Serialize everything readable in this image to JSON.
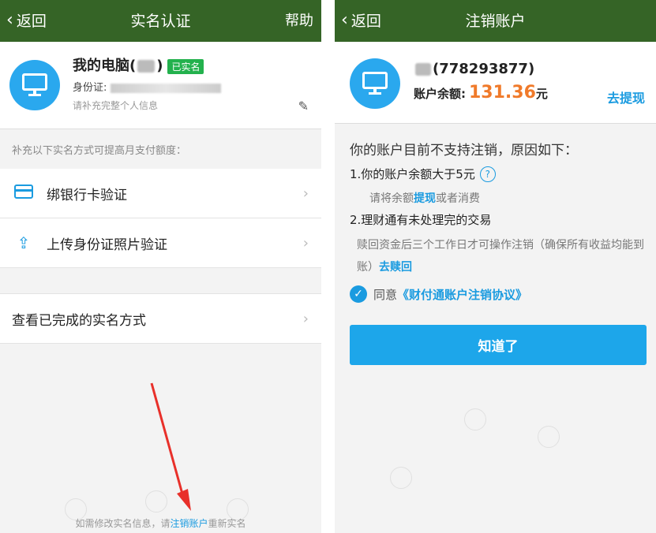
{
  "left": {
    "nav": {
      "back": "返回",
      "title": "实名认证",
      "help": "帮助"
    },
    "profile": {
      "name": "我的电脑(",
      "name_end": ")",
      "badge": "已实名",
      "id_label": "身份证:",
      "hint": "请补充完整个人信息"
    },
    "section_note": "补充以下实名方式可提高月支付额度：",
    "rows": [
      {
        "label": "绑银行卡验证",
        "icon": "bank-card-icon"
      },
      {
        "label": "上传身份证照片验证",
        "icon": "upload-icon"
      }
    ],
    "completed": "查看已完成的实名方式",
    "footer": {
      "before": "如需修改实名信息，请",
      "link": "注销账户",
      "after": "重新实名"
    },
    "colors": {
      "nav": "#356426",
      "accent": "#1a9be0",
      "badge": "#23b14d"
    }
  },
  "right": {
    "nav": {
      "back": "返回",
      "title": "注销账户"
    },
    "account": {
      "name": "(778293877)",
      "balance_label": "账户余额:",
      "balance": "131.36",
      "unit": "元",
      "withdraw": "去提现"
    },
    "reason_title": "你的账户目前不支持注销，原因如下：",
    "reason1": "1.你的账户余额大于5元",
    "reason1_sub_before": "请将余额",
    "reason1_sub_link": "提现",
    "reason1_sub_after": "或者消费",
    "reason2": "2.理财通有未处理完的交易",
    "reason2_sub": "赎回资金后三个工作日才可操作注销（确保所有收益均能到账）",
    "reason2_link": "去赎回",
    "agree_text": "同意",
    "agree_link": "《财付通账户注销协议》",
    "button": "知道了",
    "colors": {
      "balance": "#f07a2a",
      "button": "#1da6ea"
    }
  }
}
